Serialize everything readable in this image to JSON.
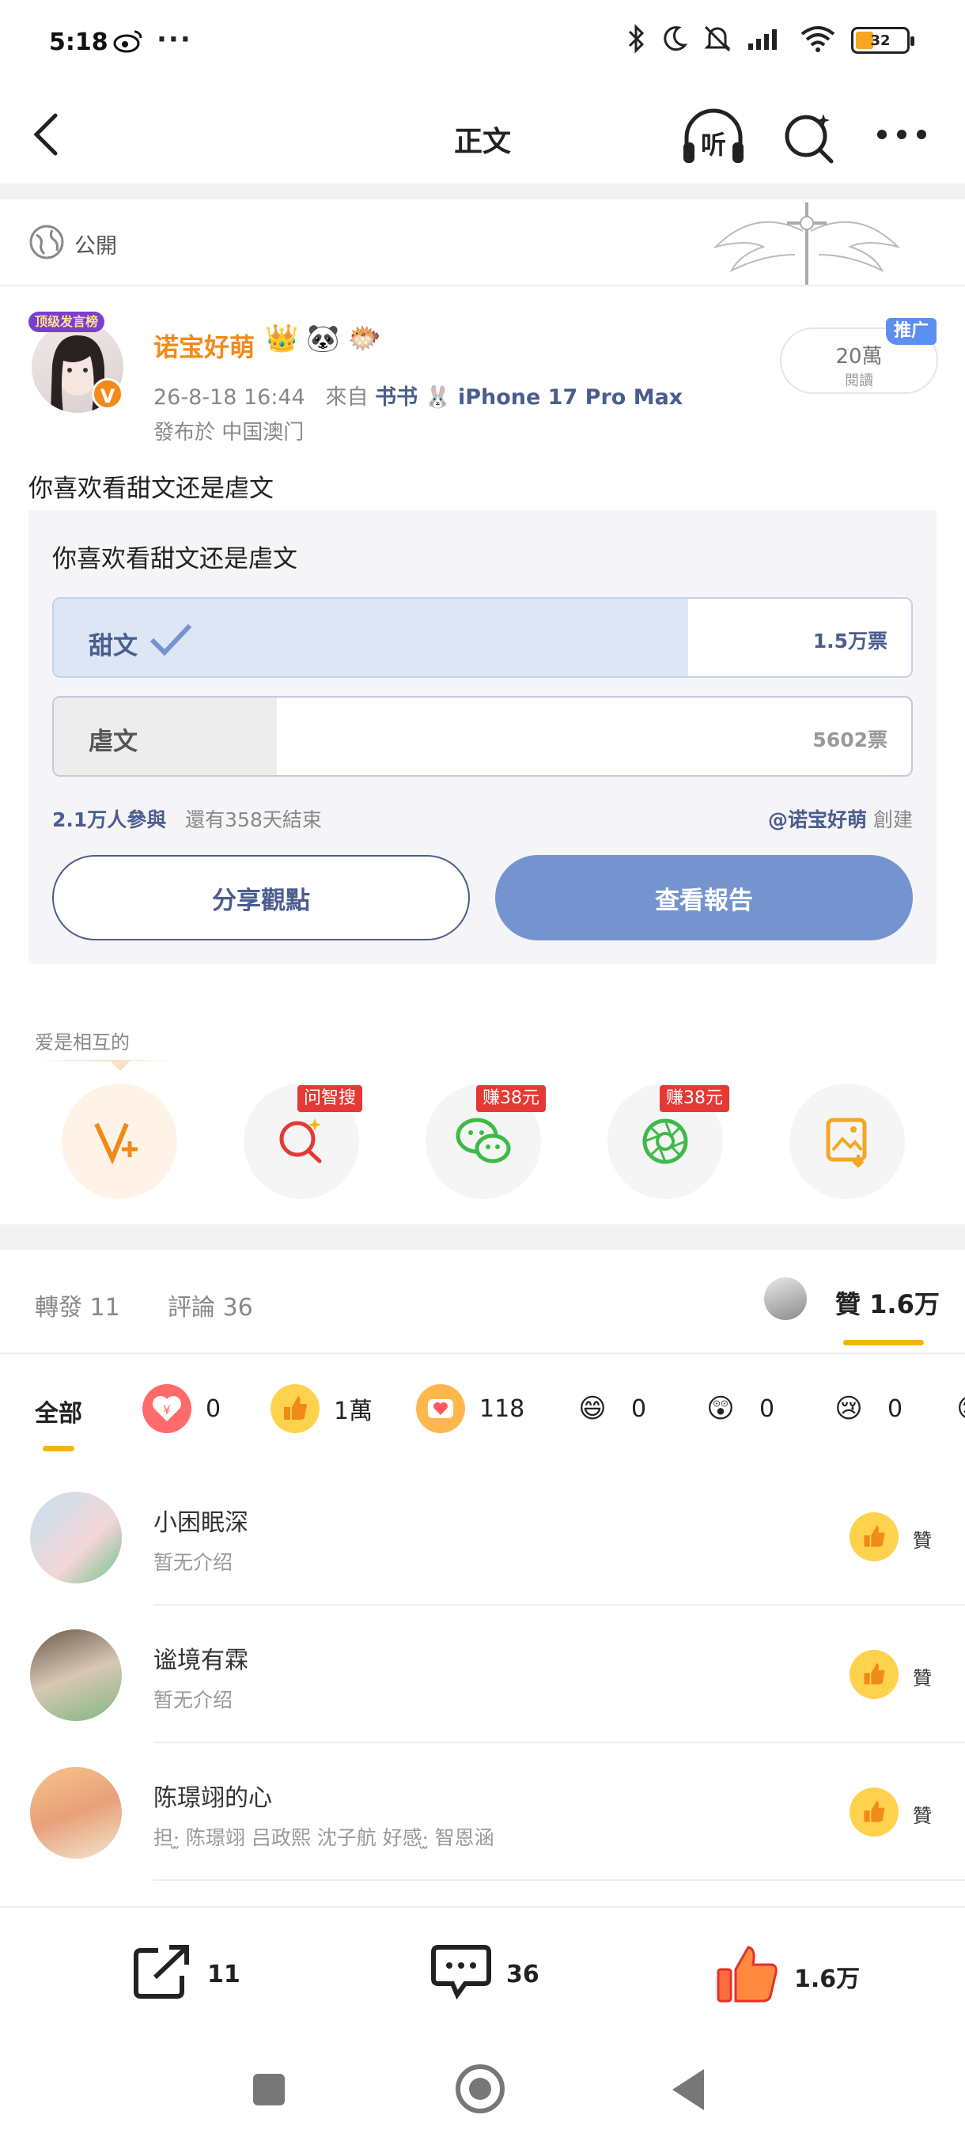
{
  "status_bar": {
    "time": "5:18",
    "battery": "32"
  },
  "nav": {
    "title": "正文",
    "listen_label": "听"
  },
  "post": {
    "visibility": "公開",
    "author": {
      "name": "诺宝好萌",
      "badge": "顶级发言榜",
      "verified": "V"
    },
    "date": "26-8-18 16:44",
    "from_label": "來自",
    "source": "书书",
    "device": "iPhone 17 Pro Max",
    "location": "發布於 中国澳门",
    "reads": {
      "count": "20萬",
      "label": "閱讀"
    },
    "promo_label": "推广",
    "text": "你喜欢看甜文还是虐文"
  },
  "poll": {
    "title": "你喜欢看甜文还是虐文",
    "options": [
      {
        "label": "甜文",
        "count": "1.5万票",
        "fraction": 0.74,
        "selected": true
      },
      {
        "label": "虐文",
        "count": "5602票",
        "fraction": 0.26,
        "selected": false
      }
    ],
    "participants": "2.1万人參與",
    "remaining": "還有358天結束",
    "creator": "@诺宝好萌",
    "created_label": "創建",
    "share_button": "分享觀點",
    "report_button": "查看報告"
  },
  "share": {
    "label": "爱是相互的",
    "items": [
      {
        "name": "vplus",
        "tag": ""
      },
      {
        "name": "ask-search",
        "tag": "问智搜"
      },
      {
        "name": "wechat",
        "tag": "赚38元"
      },
      {
        "name": "moments",
        "tag": "赚38元"
      },
      {
        "name": "save-image",
        "tag": ""
      }
    ]
  },
  "tabs": {
    "reposts": "轉發 11",
    "comments": "評論 36",
    "likes_label": "贊",
    "likes_count": "1.6万"
  },
  "reactions": {
    "all_label": "全部",
    "items": [
      {
        "icon": "red-envelope-icon",
        "count": "0",
        "color": "#ff5a5f"
      },
      {
        "icon": "thumbs-up-icon",
        "count": "1萬",
        "color": "#ffcc33"
      },
      {
        "icon": "heart-icon",
        "count": "118",
        "color": "#ffb74d"
      },
      {
        "icon": "laugh-icon",
        "count": "0",
        "color": "#ffcc33"
      },
      {
        "icon": "surprised-icon",
        "count": "0",
        "color": "#ffcc33"
      },
      {
        "icon": "sad-icon",
        "count": "0",
        "color": "#ffcc33"
      }
    ]
  },
  "likers": [
    {
      "name": "小困眠深",
      "desc": "暂无介绍",
      "like": "贊"
    },
    {
      "name": "谧境有霖",
      "desc": "暂无介绍",
      "like": "贊"
    },
    {
      "name": "陈璟翊的心",
      "desc": "担·̫ 陈璟翊 吕政熙 沈子航  好感·̫ 智恩涵",
      "like": "贊"
    }
  ],
  "bottom_bar": {
    "reposts": "11",
    "comments": "36",
    "likes": "1.6万"
  },
  "colors": {
    "accent_orange": "#f28a17",
    "link_blue": "#4a5d8e",
    "report_button": "#7594cf",
    "poll_selected_fill": "#dce6f5",
    "yellow": "#f5b400"
  }
}
